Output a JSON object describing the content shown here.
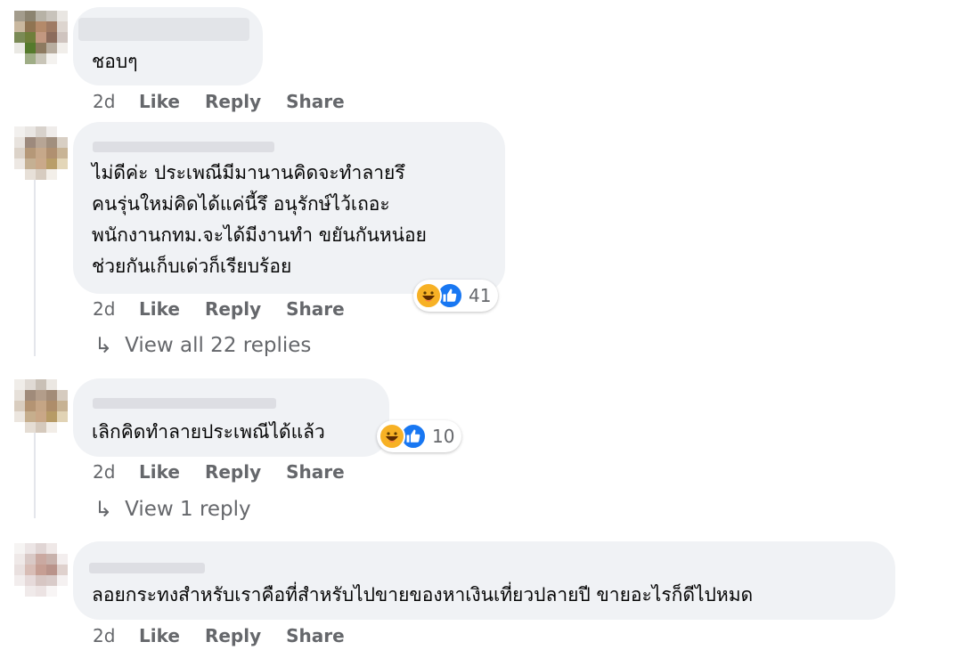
{
  "colors": {
    "bubble": "#f0f2f5",
    "secondary_text": "#65676b",
    "like_blue": "#1877f2",
    "haha_yellow": "#f7b125"
  },
  "comments": [
    {
      "text_lines": [
        "ชอบๆ"
      ],
      "time": "2d",
      "like": "Like",
      "reply": "Share_placeholder"
    }
  ],
  "c1": {
    "lines": [
      "ชอบๆ"
    ],
    "time": "2d"
  },
  "c2": {
    "lines": [
      "ไม่ดีค่ะ ประเพณีมีมานานคิดจะทำลายรึ",
      "คนรุ่นใหม่คิดได้แค่นี้รึ อนุรักษ์ไว้เถอะ",
      "พนักงานกทม.จะได้มีงานทำ ขยันกันหน่อย",
      "ช่วยกันเก็บเด่วก็เรียบร้อย"
    ],
    "time": "2d",
    "reaction_count": "41",
    "reactions": [
      "haha-icon",
      "like-icon"
    ],
    "view_replies": "View all 22 replies"
  },
  "c3": {
    "lines": [
      "เลิกคิดทำลายประเพณีได้แล้ว"
    ],
    "time": "2d",
    "reaction_count": "10",
    "reactions": [
      "haha-icon",
      "like-icon"
    ],
    "view_replies": "View 1 reply"
  },
  "c4": {
    "lines": [
      "ลอยกระทงสำหรับเราคือที่สำหรับไปขายของหาเงินเที่ยวปลายปี ขายอะไรก็ดีไปหมด"
    ],
    "time": "2d"
  },
  "labels": {
    "like": "Like",
    "reply": "Reply",
    "share": "Share"
  }
}
